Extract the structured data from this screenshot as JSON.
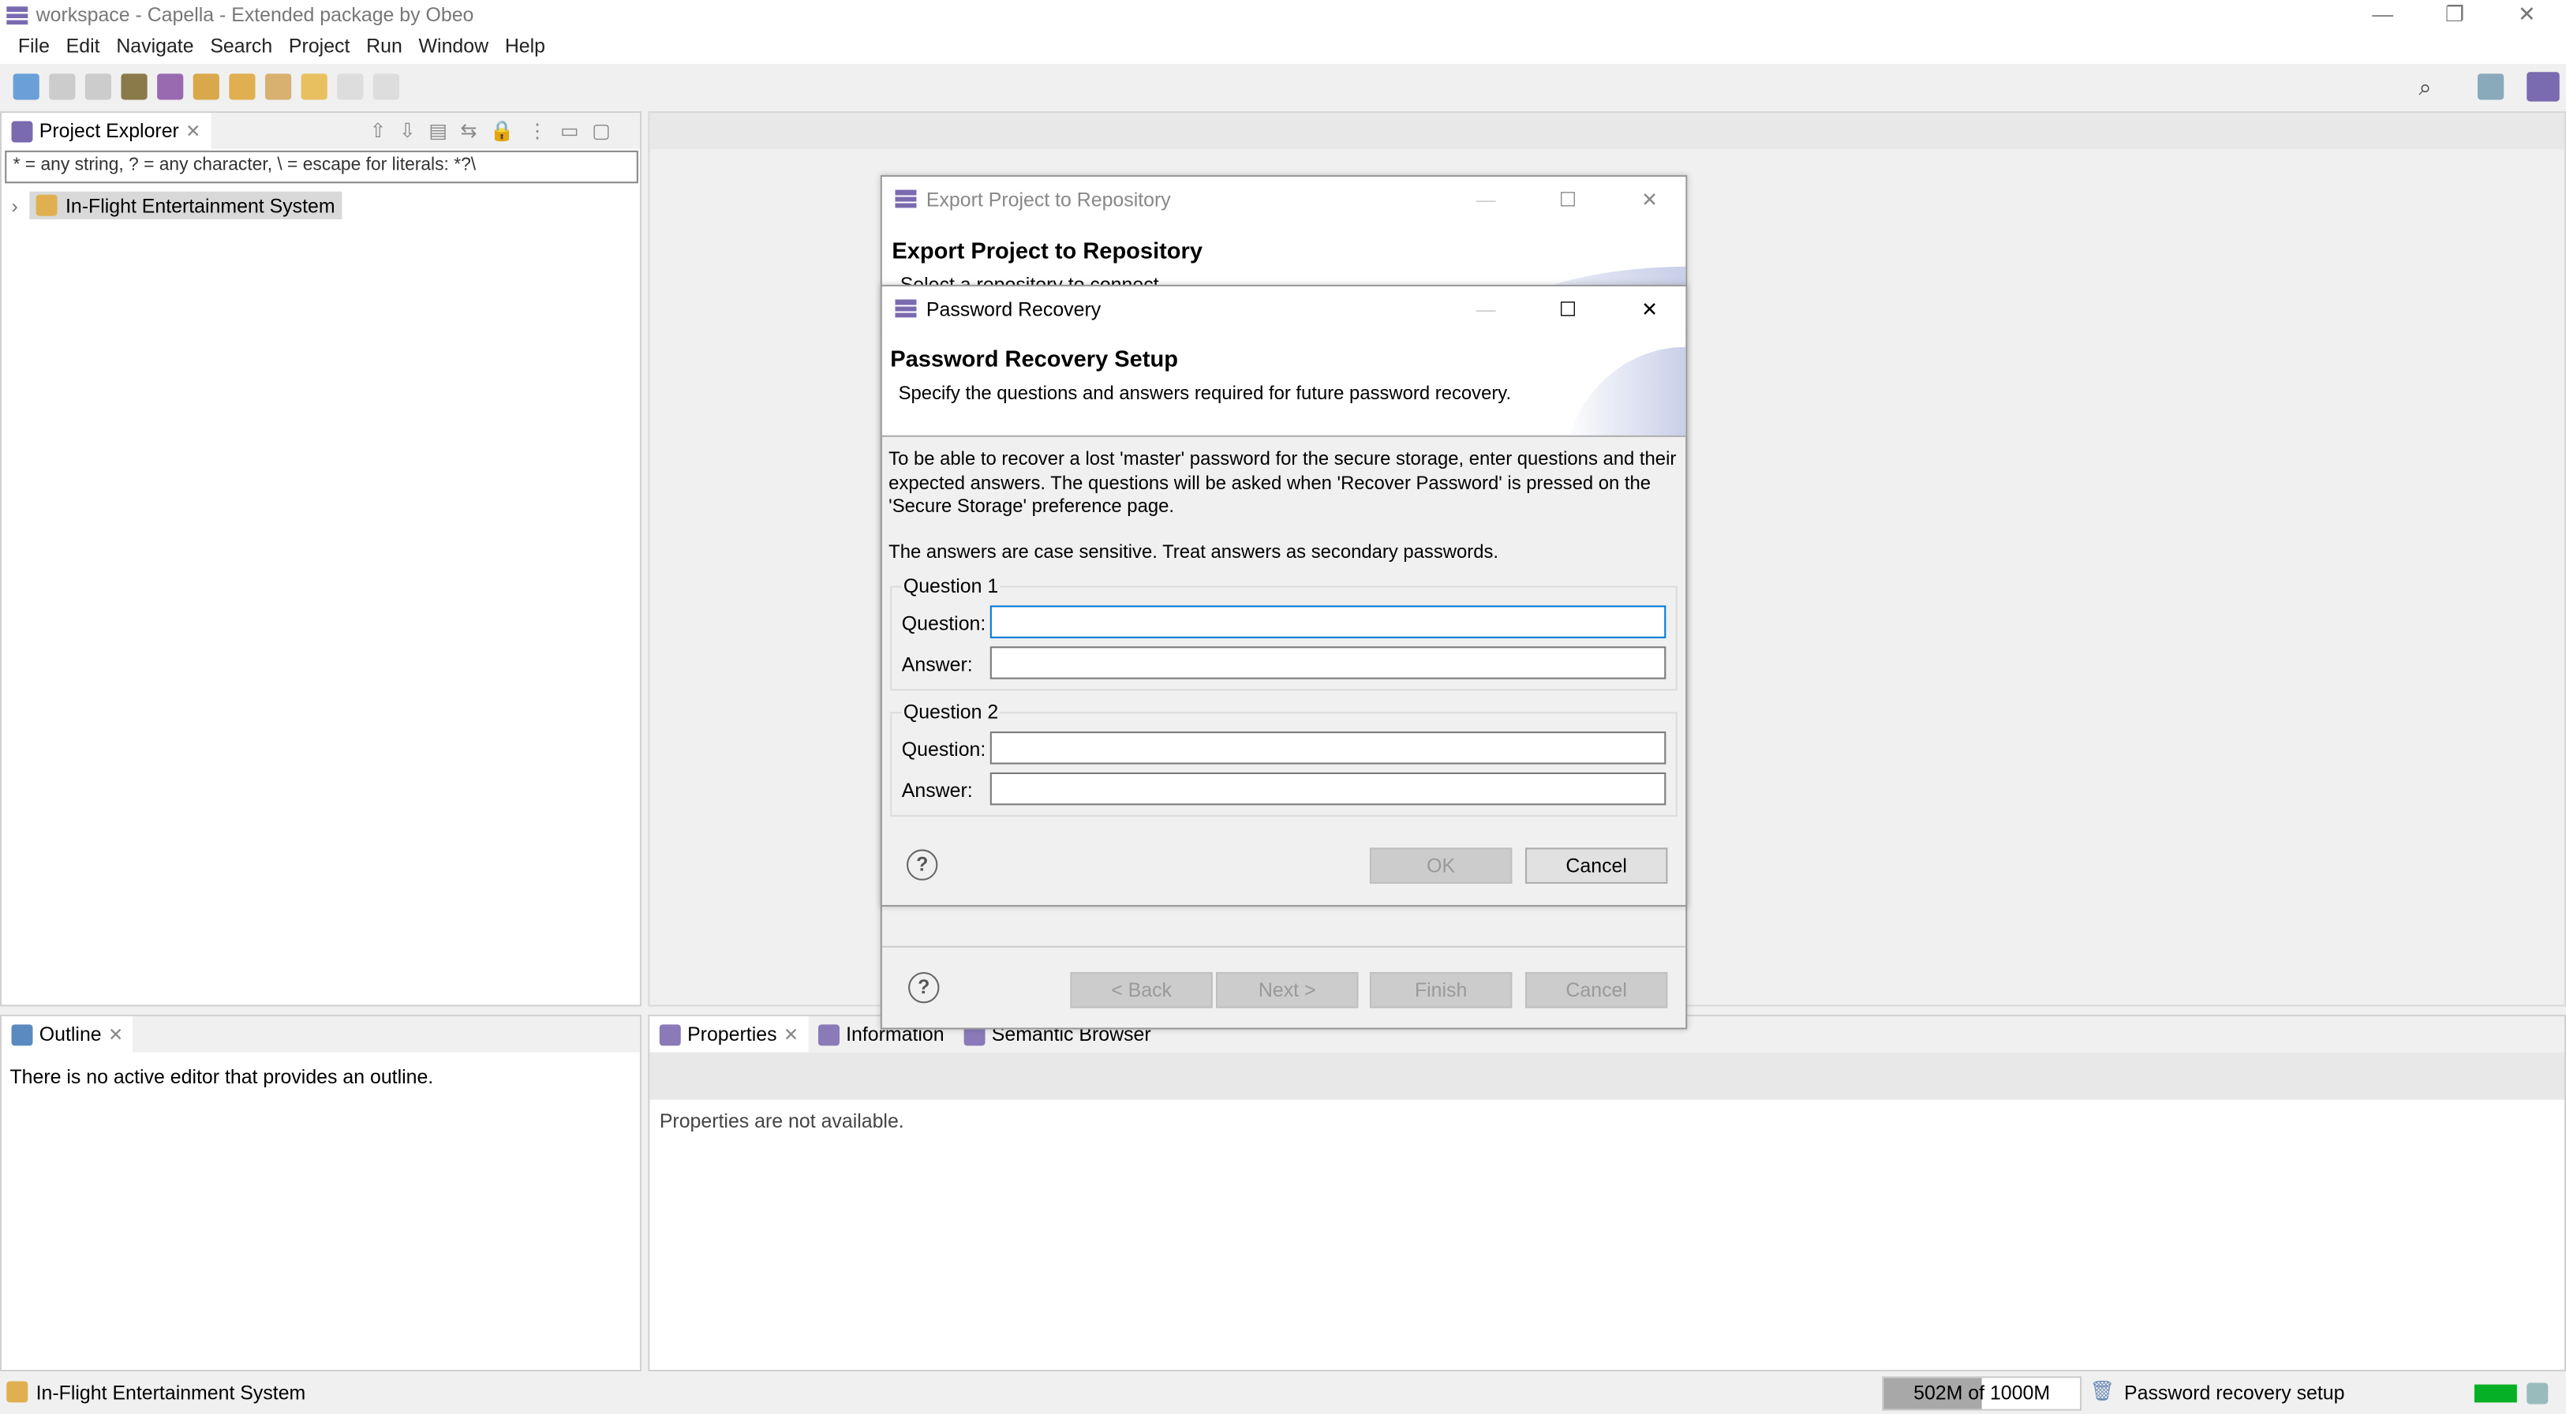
{
  "window": {
    "title": "workspace - Capella - Extended package by Obeo",
    "min": "—",
    "restore": "❐",
    "close": "✕"
  },
  "menu": [
    "File",
    "Edit",
    "Navigate",
    "Search",
    "Project",
    "Run",
    "Window",
    "Help"
  ],
  "project_explorer": {
    "tab": "Project Explorer",
    "filter_placeholder": "* = any string, ? = any character, \\ = escape for literals: *?\\",
    "tree": [
      {
        "label": "In-Flight Entertainment System",
        "selected": true
      }
    ]
  },
  "outline": {
    "tab": "Outline",
    "message": "There is no active editor that provides an outline."
  },
  "bottom": {
    "tabs": [
      "Properties",
      "Information",
      "Semantic Browser"
    ],
    "message": "Properties are not available."
  },
  "export_dialog": {
    "title": "Export Project to Repository",
    "heading": "Export Project to Repository",
    "subtitle": "Select a repository to connect.",
    "buttons": {
      "back": "< Back",
      "next": "Next >",
      "finish": "Finish",
      "cancel": "Cancel"
    }
  },
  "password_dialog": {
    "title": "Password Recovery",
    "heading": "Password Recovery Setup",
    "subtitle": "Specify the questions and answers required for future password recovery.",
    "intro": "To be able to recover a lost 'master' password for the secure storage, enter questions and their expected answers. The questions will be asked when 'Recover Password' is pressed on the 'Secure Storage' preference page.",
    "note": "The answers are case sensitive. Treat answers as secondary passwords.",
    "groups": [
      {
        "label": "Question 1",
        "question_label": "Question:",
        "answer_label": "Answer:",
        "question": "",
        "answer": ""
      },
      {
        "label": "Question 2",
        "question_label": "Question:",
        "answer_label": "Answer:",
        "question": "",
        "answer": ""
      }
    ],
    "ok": "OK",
    "cancel": "Cancel"
  },
  "status": {
    "selection": "In-Flight Entertainment System",
    "heap": "502M of 1000M",
    "heap_fraction": 0.502,
    "message": "Password recovery setup"
  },
  "colors": {
    "accent": "#7a6ab0",
    "focus": "#0078d7",
    "progress": "#06b025"
  }
}
